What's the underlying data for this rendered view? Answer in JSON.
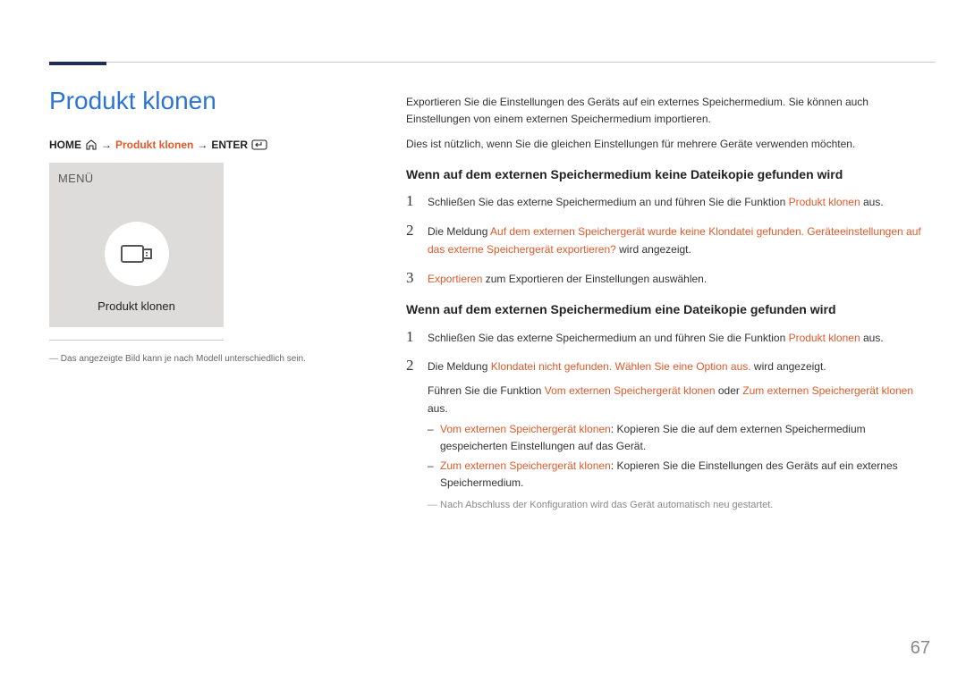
{
  "page_title": "Produkt klonen",
  "page_number": "67",
  "breadcrumb": {
    "home": "HOME",
    "arrow": "→",
    "item": "Produkt klonen",
    "enter": "ENTER"
  },
  "sidebar": {
    "menu_label": "MENÜ",
    "item_label": "Produkt klonen",
    "note": "Das angezeigte Bild kann je nach Modell unterschiedlich sein."
  },
  "intro": {
    "p1": "Exportieren Sie die Einstellungen des Geräts auf ein externes Speichermedium. Sie können auch Einstellungen von einem externen Speichermedium importieren.",
    "p2": "Dies ist nützlich, wenn Sie die gleichen Einstellungen für mehrere Geräte verwenden möchten."
  },
  "section1": {
    "heading": "Wenn auf dem externen Speichermedium keine Dateikopie gefunden wird",
    "step1": {
      "num": "1",
      "pre": "Schließen Sie das externe Speichermedium an und führen Sie die Funktion ",
      "hl": "Produkt klonen",
      "post": " aus."
    },
    "step2": {
      "num": "2",
      "pre": "Die Meldung ",
      "hl": "Auf dem externen Speichergerät wurde keine Klondatei gefunden. Geräteeinstellungen auf das externe Speichergerät exportieren?",
      "post": " wird angezeigt."
    },
    "step3": {
      "num": "3",
      "hl": "Exportieren",
      "post": " zum Exportieren der Einstellungen auswählen."
    }
  },
  "section2": {
    "heading": "Wenn auf dem externen Speichermedium eine Dateikopie gefunden wird",
    "step1": {
      "num": "1",
      "pre": "Schließen Sie das externe Speichermedium an und führen Sie die Funktion ",
      "hl": "Produkt klonen",
      "post": " aus."
    },
    "step2": {
      "num": "2",
      "pre": "Die Meldung ",
      "hl": "Klondatei nicht gefunden. Wählen Sie eine Option aus.",
      "post": " wird angezeigt.",
      "sub_pre": "Führen Sie die Funktion ",
      "sub_hl1": "Vom externen Speichergerät klonen",
      "sub_mid": " oder ",
      "sub_hl2": "Zum externen Speichergerät klonen",
      "sub_post": " aus.",
      "b1_hl": "Vom externen Speichergerät klonen",
      "b1_txt": ": Kopieren Sie die auf dem externen Speichermedium gespeicherten Einstellungen auf das Gerät.",
      "b2_hl": "Zum externen Speichergerät klonen",
      "b2_txt": ": Kopieren Sie die Einstellungen des Geräts auf ein externes Speichermedium.",
      "footnote": "Nach Abschluss der Konfiguration wird das Gerät automatisch neu gestartet."
    }
  }
}
